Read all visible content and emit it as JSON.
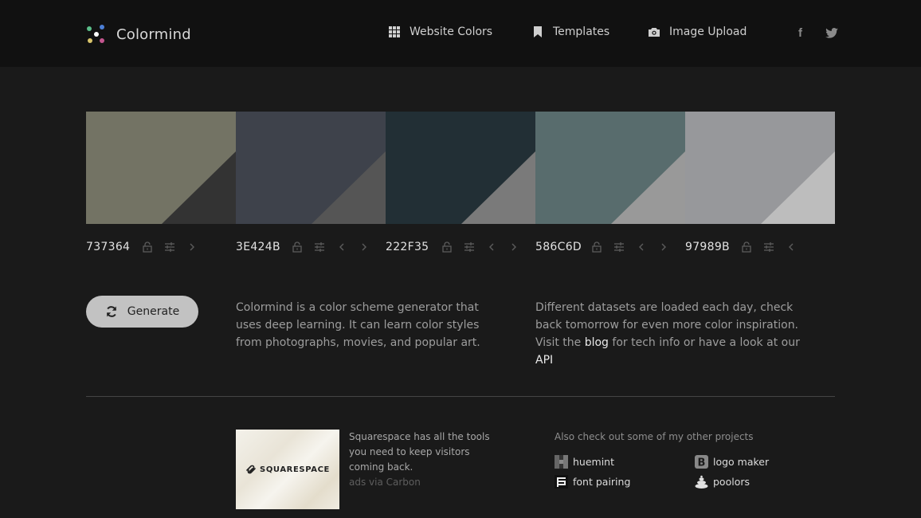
{
  "header": {
    "app_name": "Colormind",
    "nav": [
      {
        "label": "Website Colors",
        "icon": "grid-icon"
      },
      {
        "label": "Templates",
        "icon": "bookmark-icon"
      },
      {
        "label": "Image Upload",
        "icon": "camera-icon"
      }
    ],
    "social": [
      {
        "label": "f",
        "icon": "facebook-icon"
      },
      {
        "label": "twitter",
        "icon": "twitter-icon"
      }
    ]
  },
  "palette": [
    {
      "hex": "737364",
      "color": "#737364",
      "shade": "#333333",
      "controls": [
        "lock",
        "adjust",
        "next"
      ]
    },
    {
      "hex": "3E424B",
      "color": "#3E424B",
      "shade": "#555555",
      "controls": [
        "lock",
        "adjust",
        "prev",
        "next"
      ]
    },
    {
      "hex": "222F35",
      "color": "#222F35",
      "shade": "#7a7a7a",
      "controls": [
        "lock",
        "adjust",
        "prev",
        "next"
      ]
    },
    {
      "hex": "586C6D",
      "color": "#586C6D",
      "shade": "#999999",
      "controls": [
        "lock",
        "adjust",
        "prev",
        "next"
      ]
    },
    {
      "hex": "97989B",
      "color": "#97989B",
      "shade": "#bdbdbd",
      "controls": [
        "lock",
        "adjust",
        "prev"
      ]
    }
  ],
  "generate": {
    "label": "Generate"
  },
  "about": {
    "text": "Colormind is a color scheme generator that uses deep learning. It can learn color styles from photographs, movies, and popular art."
  },
  "info": {
    "text_before": "Different datasets are loaded each day, check back tomorrow for even more color inspiration. Visit the ",
    "blog_link": "blog",
    "text_middle": " for tech info or have a look at our ",
    "api_link": "API"
  },
  "ad": {
    "brand": "SQUARESPACE",
    "text": "Squarespace has all the tools you need to keep visitors coming back.",
    "via": "ads via Carbon"
  },
  "projects": {
    "title": "Also check out some of my other projects",
    "items": [
      {
        "label": "huemint",
        "icon": "huemint-icon"
      },
      {
        "label": "logo maker",
        "icon": "logo-maker-icon"
      },
      {
        "label": "font pairing",
        "icon": "font-pairing-icon"
      },
      {
        "label": "poolors",
        "icon": "poolors-icon"
      }
    ]
  }
}
